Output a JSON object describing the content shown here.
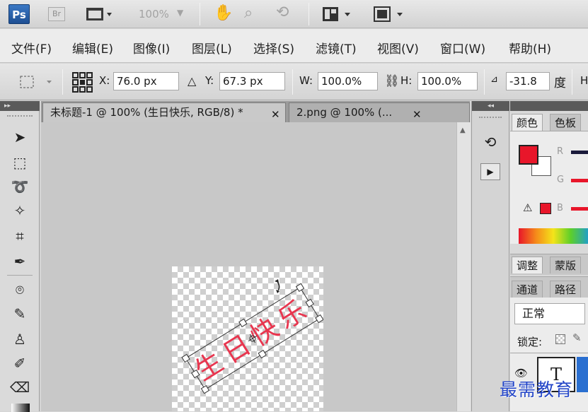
{
  "appbar": {
    "logo": "Ps",
    "bridge": "Br",
    "zoom": "100%"
  },
  "menu": {
    "items": [
      "文件(F)",
      "编辑(E)",
      "图像(I)",
      "图层(L)",
      "选择(S)",
      "滤镜(T)",
      "视图(V)",
      "窗口(W)",
      "帮助(H)"
    ]
  },
  "options": {
    "x_label": "X:",
    "x_value": "76.0 px",
    "y_label": "Y:",
    "y_value": "67.3 px",
    "w_label": "W:",
    "w_value": "100.0%",
    "h_label": "H:",
    "h_value": "100.0%",
    "angle_value": "-31.8",
    "angle_unit": "度",
    "h_trunc": "H"
  },
  "tabs": [
    {
      "label": "未标题-1 @ 100% (生日快乐, RGB/8) *",
      "close": "✕"
    },
    {
      "label": "2.png @ 100% (...",
      "close": "✕"
    }
  ],
  "canvas": {
    "text": "生日快乐",
    "text_color": "#e8364f"
  },
  "panels": {
    "color_tabs": [
      "颜色",
      "色板"
    ],
    "channel_labels": [
      "R",
      "G",
      "B"
    ],
    "adjust_tabs": [
      "调整",
      "蒙版"
    ],
    "channel_tabs": [
      "通道",
      "路径"
    ],
    "blend_mode": "正常",
    "lock_label": "锁定:",
    "layer_thumb": "T",
    "fg_color": "#e8162a",
    "bg_color": "#ffffff"
  },
  "watermark": "最需教育"
}
